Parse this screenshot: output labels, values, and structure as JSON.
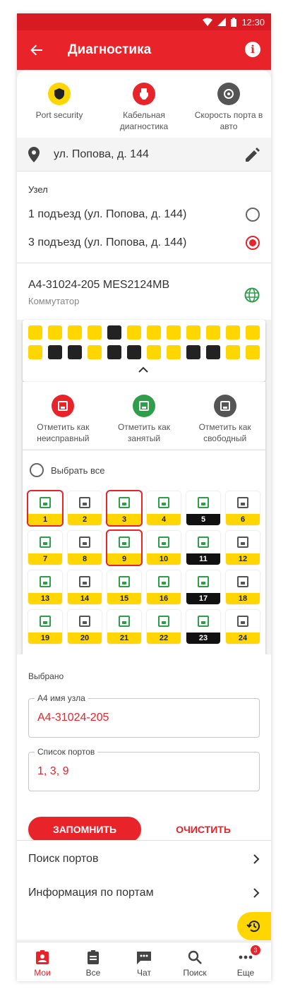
{
  "status_bar": {
    "time": "12:30"
  },
  "header": {
    "title": "Диагностика"
  },
  "quick_actions": [
    {
      "label": "Port security",
      "color": "#ffd600",
      "icon": "shield-icon"
    },
    {
      "label": "Кабельная диагностика",
      "color": "#e8232a",
      "icon": "cable-icon"
    },
    {
      "label": "Скорость порта в авто",
      "color": "#555555",
      "icon": "speed-icon"
    }
  ],
  "address": {
    "text": "ул. Попова, д. 144"
  },
  "node": {
    "label": "Узел",
    "options": [
      {
        "label": "1 подъезд (ул. Попова, д. 144)",
        "selected": false
      },
      {
        "label": "3 подъезд (ул. Попова, д. 144)",
        "selected": true
      }
    ]
  },
  "switch": {
    "name": "A4-31024-205 MES2124MB",
    "type": "Коммутатор"
  },
  "mini_ports": {
    "row1": [
      "y",
      "y",
      "y",
      "y",
      "b",
      "y",
      "y",
      "y",
      "y",
      "y",
      "y",
      "y"
    ],
    "row2": [
      "y",
      "b",
      "b",
      "y",
      "b",
      "b",
      "y",
      "y",
      "b",
      "b",
      "y",
      "y"
    ]
  },
  "mark_actions": [
    {
      "label": "Отметить как неисправный",
      "color": "#e8232a"
    },
    {
      "label": "Отметить как занятый",
      "color": "#2e9e4a"
    },
    {
      "label": "Отметить как свободный",
      "color": "#555555"
    }
  ],
  "select_all_label": "Выбрать все",
  "ports": [
    {
      "n": "1",
      "icon": "g",
      "dark": false,
      "sel": true
    },
    {
      "n": "2",
      "icon": "k",
      "dark": false,
      "sel": false
    },
    {
      "n": "3",
      "icon": "g",
      "dark": false,
      "sel": true
    },
    {
      "n": "4",
      "icon": "g",
      "dark": false,
      "sel": false
    },
    {
      "n": "5",
      "icon": "g",
      "dark": true,
      "sel": false
    },
    {
      "n": "6",
      "icon": "k",
      "dark": false,
      "sel": false
    },
    {
      "n": "7",
      "icon": "g",
      "dark": false,
      "sel": false
    },
    {
      "n": "8",
      "icon": "k",
      "dark": false,
      "sel": false
    },
    {
      "n": "9",
      "icon": "g",
      "dark": false,
      "sel": true
    },
    {
      "n": "10",
      "icon": "g",
      "dark": false,
      "sel": false
    },
    {
      "n": "11",
      "icon": "g",
      "dark": true,
      "sel": false
    },
    {
      "n": "12",
      "icon": "k",
      "dark": false,
      "sel": false
    },
    {
      "n": "13",
      "icon": "g",
      "dark": false,
      "sel": false
    },
    {
      "n": "14",
      "icon": "k",
      "dark": false,
      "sel": false
    },
    {
      "n": "15",
      "icon": "g",
      "dark": false,
      "sel": false
    },
    {
      "n": "16",
      "icon": "g",
      "dark": false,
      "sel": false
    },
    {
      "n": "17",
      "icon": "g",
      "dark": true,
      "sel": false
    },
    {
      "n": "18",
      "icon": "k",
      "dark": false,
      "sel": false
    },
    {
      "n": "19",
      "icon": "g",
      "dark": false,
      "sel": false
    },
    {
      "n": "20",
      "icon": "k",
      "dark": false,
      "sel": false
    },
    {
      "n": "21",
      "icon": "g",
      "dark": false,
      "sel": false
    },
    {
      "n": "22",
      "icon": "g",
      "dark": false,
      "sel": false
    },
    {
      "n": "23",
      "icon": "g",
      "dark": true,
      "sel": false
    },
    {
      "n": "24",
      "icon": "k",
      "dark": false,
      "sel": false
    }
  ],
  "selected": {
    "label": "Выбрано",
    "node_name_label": "A4 имя узла",
    "node_name_value": "A4-31024-205",
    "ports_label": "Список портов",
    "ports_value": "1, 3, 9",
    "save_label": "ЗАПОМНИТЬ",
    "clear_label": "ОЧИСТИТЬ"
  },
  "links": [
    {
      "label": "Поиск портов"
    },
    {
      "label": "Информация по портам"
    }
  ],
  "bottom_nav": [
    {
      "label": "Мои",
      "icon": "person-badge-icon",
      "active": true
    },
    {
      "label": "Все",
      "icon": "clipboard-icon",
      "active": false
    },
    {
      "label": "Чат",
      "icon": "chat-icon",
      "active": false
    },
    {
      "label": "Поиск",
      "icon": "search-icon",
      "active": false
    },
    {
      "label": "Еще",
      "icon": "more-icon",
      "active": false,
      "badge": "3"
    }
  ],
  "colors": {
    "accent": "#e8232a",
    "yellow": "#ffd600",
    "green": "#2e9e4a"
  }
}
